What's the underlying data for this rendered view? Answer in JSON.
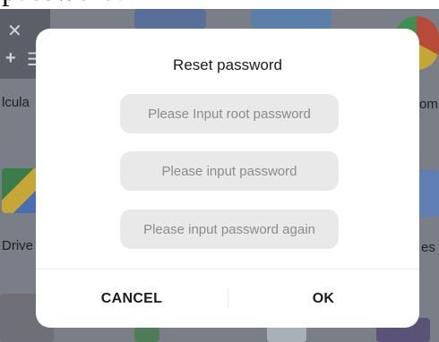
{
  "caption_fragment": "password.",
  "home_screen": {
    "labels": {
      "calculator_partial": "lcula",
      "chrome_partial": "om",
      "drive_partial": "Drive",
      "files_partial": "es"
    },
    "icons": [
      "close-icon",
      "add-icon",
      "menu-icon"
    ]
  },
  "dialog": {
    "title": "Reset password",
    "root_password_placeholder": "Please Input root password",
    "password_placeholder": "Please input password",
    "password_again_placeholder": "Please input password again",
    "cancel_label": "CANCEL",
    "ok_label": "OK"
  },
  "colors": {
    "dialog_bg": "#ffffff",
    "field_bg": "#e9e9e9",
    "scrim": "#7a7f87"
  }
}
